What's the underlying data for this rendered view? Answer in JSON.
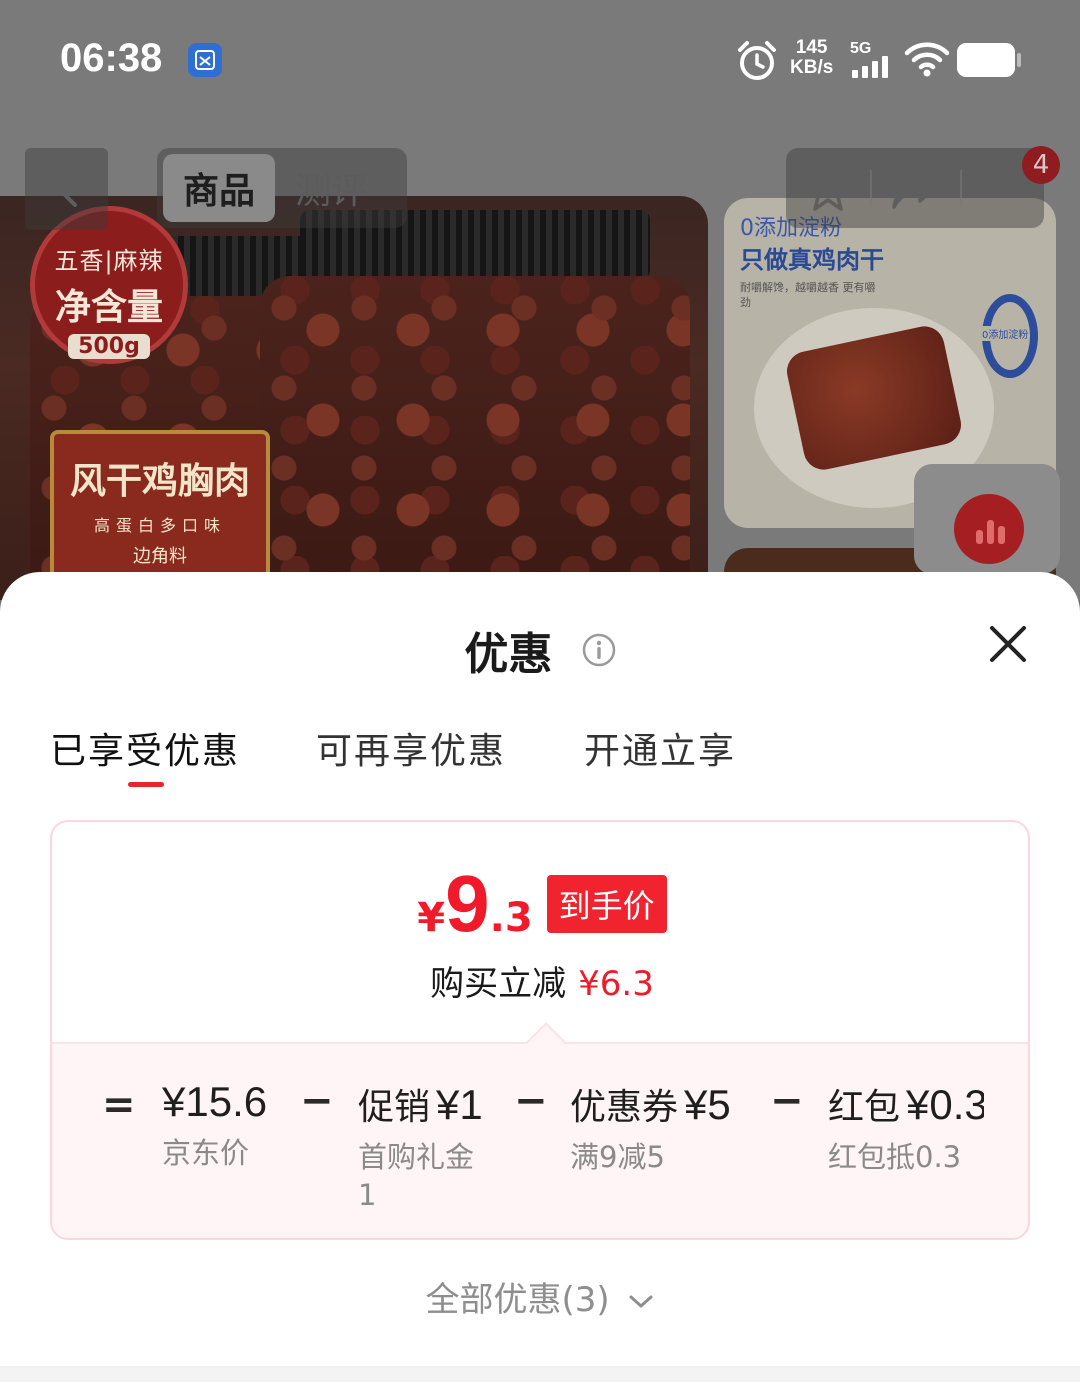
{
  "status_bar": {
    "time": "06:38",
    "speed_value": "145",
    "speed_unit": "KB/s",
    "network": "5G"
  },
  "top_nav": {
    "tabs": [
      "商品",
      "测评"
    ],
    "cart_count": "4"
  },
  "background_images": {
    "main_badge_line1": "五香|麻辣",
    "main_badge_line2": "净含量",
    "main_badge_weight": "500g",
    "main_label_title": "风干鸡胸肉",
    "main_label_sub": "高蛋白多口味",
    "main_label_tag": "边角料",
    "side_line1": "0添加淀粉",
    "side_line2": "只做真鸡肉干",
    "side_small": "耐嚼解馋，越嚼越香 更有嚼劲",
    "side_zero_label": "0添加淀粉"
  },
  "sheet": {
    "title": "优惠",
    "tabs": [
      "已享受优惠",
      "可再享优惠",
      "开通立享"
    ],
    "active_tab": 0,
    "price": {
      "currency": "¥",
      "integer": "9",
      "decimal": ".3",
      "tag": "到手价"
    },
    "saving": {
      "label": "购买立减",
      "amount": "¥6.3"
    },
    "breakdown": {
      "equals": "=",
      "minus": "−",
      "items": [
        {
          "label": "",
          "value": "¥15.6",
          "sub": "京东价"
        },
        {
          "label": "促销",
          "value": "¥1",
          "sub": "首购礼金1"
        },
        {
          "label": "优惠券",
          "value": "¥5",
          "sub": "满9减5"
        },
        {
          "label": "红包",
          "value": "¥0.3",
          "sub": "红包抵0.3"
        }
      ]
    },
    "all_deals": "全部优惠(3)"
  },
  "colors": {
    "accent_red": "#f01a2a",
    "card_border": "#fbd6de",
    "breakdown_bg": "#fff5f7"
  }
}
